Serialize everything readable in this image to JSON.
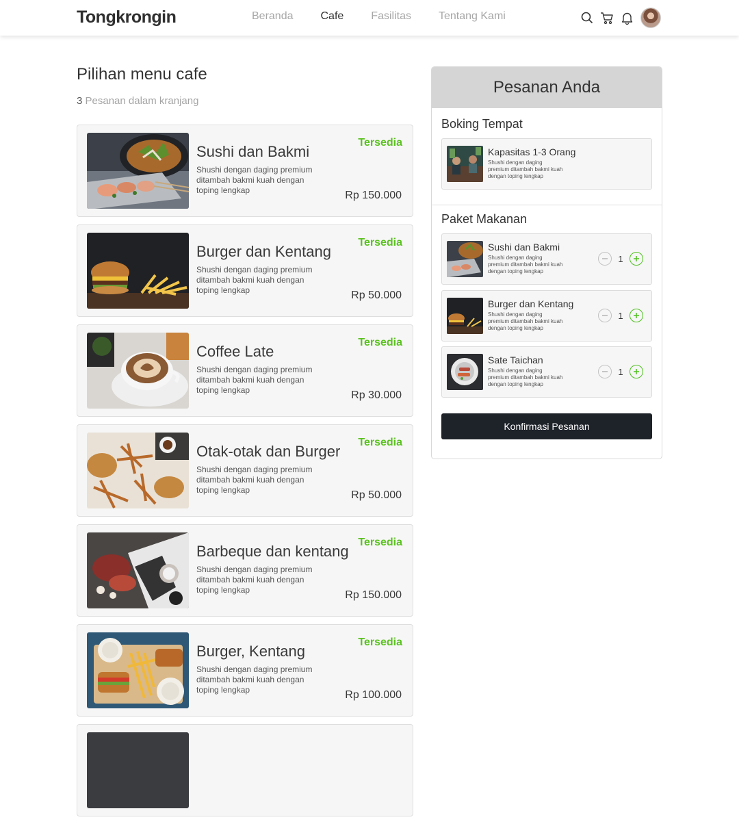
{
  "header": {
    "brand": "Tongkrongin",
    "nav": [
      "Beranda",
      "Cafe",
      "Fasilitas",
      "Tentang Kami"
    ],
    "active_nav": "Cafe",
    "icons": [
      "search-icon",
      "cart-icon",
      "bell-icon",
      "user-avatar"
    ]
  },
  "main": {
    "title": "Pilihan menu cafe",
    "cart_count": "3",
    "cart_label": "Pesanan dalam kranjang",
    "items": [
      {
        "name": "Sushi dan Bakmi",
        "desc": "Shushi dengan daging premium ditambah bakmi kuah dengan toping lengkap",
        "status": "Tersedia",
        "price": "Rp 150.000"
      },
      {
        "name": "Burger dan Kentang",
        "desc": "Shushi dengan daging premium ditambah bakmi kuah dengan toping lengkap",
        "status": "Tersedia",
        "price": "Rp 50.000"
      },
      {
        "name": "Coffee Late",
        "desc": "Shushi dengan daging premium ditambah bakmi kuah dengan toping lengkap",
        "status": "Tersedia",
        "price": "Rp 30.000"
      },
      {
        "name": "Otak-otak dan Burger",
        "desc": "Shushi dengan daging premium ditambah bakmi kuah dengan toping lengkap",
        "status": "Tersedia",
        "price": "Rp 50.000"
      },
      {
        "name": "Barbeque dan kentang",
        "desc": "Shushi dengan daging premium ditambah bakmi kuah dengan toping lengkap",
        "status": "Tersedia",
        "price": "Rp 150.000"
      },
      {
        "name": "Burger, Kentang",
        "desc": "Shushi dengan daging premium ditambah bakmi kuah dengan toping lengkap",
        "status": "Tersedia",
        "price": "Rp 100.000"
      }
    ]
  },
  "order": {
    "title": "Pesanan Anda",
    "booking_title": "Boking Tempat",
    "booking": {
      "name": "Kapasitas 1-3 Orang",
      "desc": "Shushi dengan daging premium ditambah bakmi kuah dengan toping lengkap"
    },
    "package_title": "Paket Makanan",
    "packages": [
      {
        "name": "Sushi dan Bakmi",
        "desc": "Shushi dengan daging premium ditambah bakmi kuah dengan toping lengkap",
        "qty": "1"
      },
      {
        "name": "Burger dan Kentang",
        "desc": "Shushi dengan daging premium ditambah bakmi kuah dengan toping lengkap",
        "qty": "1"
      },
      {
        "name": "Sate Taichan",
        "desc": "Shushi dengan daging premium ditambah bakmi kuah dengan toping lengkap",
        "qty": "1"
      }
    ],
    "confirm_label": "Konfirmasi Pesanan"
  },
  "colors": {
    "accent_green": "#5ac21f",
    "dark_button": "#1e2229",
    "panel_header": "#d5d5d5"
  }
}
